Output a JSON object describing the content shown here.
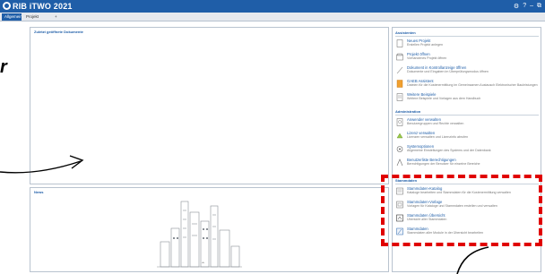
{
  "window": {
    "title": "RIB iTWO 2021",
    "controls": [
      "⚙",
      "?",
      "–",
      "⧉"
    ]
  },
  "tabs": [
    {
      "label": "Allgemein",
      "active": true
    },
    {
      "label": "Projekt",
      "active": false
    },
    {
      "label": "+",
      "active": false
    }
  ],
  "recent_panel": {
    "title": "Zuletzt geöffnete Dokumente"
  },
  "news_panel": {
    "title": "News"
  },
  "tasks_panel": {
    "sections": [
      {
        "title": "Assistenten",
        "items": [
          {
            "title": "Neues Projekt",
            "desc": "Erstellen Projekt anlegen",
            "icon": "new-project-icon"
          },
          {
            "title": "Projekt öffnen",
            "desc": "Vorhandenes Projekt öffnen",
            "icon": "open-project-icon"
          },
          {
            "title": "Dokument in Kontrollanzeige öffnen",
            "desc": "Dokumente und Eingaben im Überprüfungsmodus öffnen",
            "icon": "document-icon"
          },
          {
            "title": "GAEB Assistent",
            "desc": "Dateien für die Kostenermittlung im Gemeinsamen Austausch Elektronischer Bauleistungen",
            "icon": "gaeb-icon"
          },
          {
            "title": "Weitere Beispiele",
            "desc": "Weitere Beispiele und Vorlagen aus dem Handbuch",
            "icon": "examples-icon"
          }
        ]
      },
      {
        "title": "Administration",
        "items": [
          {
            "title": "Anwender verwalten",
            "desc": "Benutzergruppen und Rechte verwalten",
            "icon": "users-icon"
          },
          {
            "title": "Lizenz verwalten",
            "desc": "Lizenzen verwalten und Lizenzinfo abrufen",
            "icon": "license-icon"
          },
          {
            "title": "Systemoptionen",
            "desc": "Allgemeine Einstellungen des Systems und der Datenbank",
            "icon": "options-icon"
          },
          {
            "title": "Benutzerliste Berechtigungen",
            "desc": "Berechtigungen der Benutzer für einzelne Bereiche",
            "icon": "permissions-icon"
          }
        ]
      },
      {
        "title": "Stammdaten",
        "items": [
          {
            "title": "Stammdaten-Katalog",
            "desc": "Kataloge bearbeiten und Stammdaten für die Kostenermittlung verwalten",
            "icon": "catalog-icon"
          },
          {
            "title": "Stammdaten-Vorlage",
            "desc": "Vorlagen für Kataloge und Stammdaten erstellen und verwalten",
            "icon": "template-icon"
          },
          {
            "title": "Stammdaten Übersicht",
            "desc": "Übersicht aller Stammdaten",
            "icon": "overview-icon"
          },
          {
            "title": "Stammdaten",
            "desc": "Stammdaten aller Module in der Übersicht bearbeiten",
            "icon": "masterdata-icon"
          }
        ]
      }
    ]
  },
  "annotation": {
    "word": "r"
  },
  "colors": {
    "accent": "#1f5ea8",
    "highlight": "#e00000"
  }
}
